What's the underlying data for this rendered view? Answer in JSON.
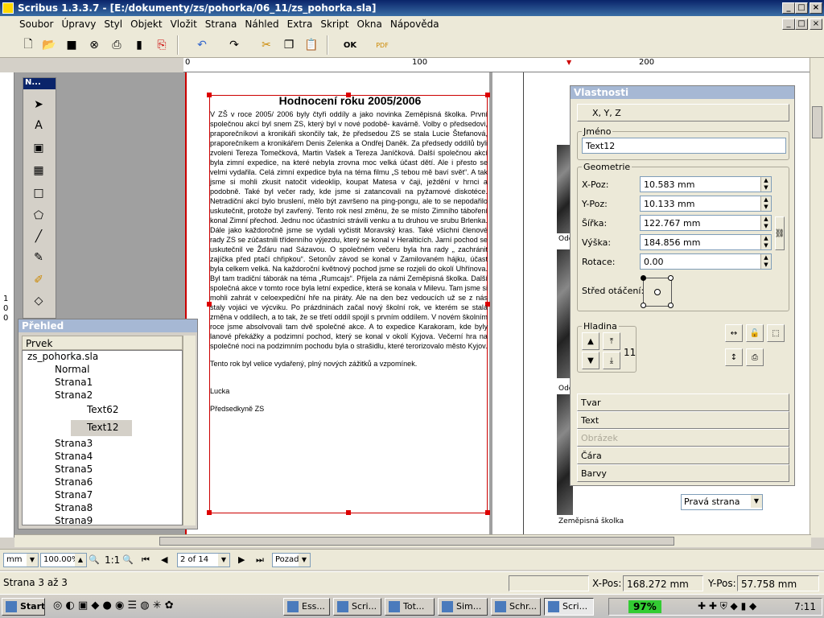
{
  "window": {
    "title": "Scribus 1.3.3.7 - [E:/dokumenty/zs/pohorka/06_11/zs_pohorka.sla]"
  },
  "menu": [
    "Soubor",
    "Úpravy",
    "Styl",
    "Objekt",
    "Vložit",
    "Strana",
    "Náhled",
    "Extra",
    "Skript",
    "Okna",
    "Nápověda"
  ],
  "ruler": {
    "h": [
      "0",
      "100",
      "200"
    ],
    "v": [
      "1",
      "0",
      "0"
    ]
  },
  "document": {
    "title": "Hodnocení roku 2005/2006",
    "paragraphs": [
      "V ZŠ v roce 2005/ 2006 byly čtyři oddíly a jako novinka Zeměpisná školka. První společnou akcí byl snem ZS, který byl v nové podobě- kavárně. Volby o předsedovi, praporečníkovi a kronikáři skončily tak, že předsedou ZS se stala Lucie Štefanová, praporečníkem a kronikářem Denis Zelenka a Ondřej Daněk. Za předsedy oddílů byli zvoleni Tereza Tomečková, Martin Vašek a Tereza Janíčková. Další společnou akcí byla zimní expedice, na které nebyla zrovna moc velká účast dětí. Ale i přesto se velmi vydařila. Celá zimní expedice byla na téma filmu „S tebou mě baví svět“. A tak jsme si mohli zkusit natočit videoklip, koupat Matesa v čaji, ježdění v hrnci a podobně. Také byl večer rady, kde jsme si zatancovali na pyžamové diskotéce. Netradiční akcí bylo bruslení, mělo být završeno na ping-pongu, ale to se nepodařilo uskutečnit, protože byl zavřený. Tento rok nesl změnu, že se místo Zimního táboření konal Zimní přechod. Jednu noc účastníci strávili venku a tu druhou ve srubu Brlenka. Dále jako každoročně jsme se vydali vyčistit Moravský kras. Také všichni členové rady ZS se zúčastnili třídenního výjezdu, který se konal v Heralticích. Jarní pochod se uskutečnil ve Žďáru nad Sázavou. O společném večeru byla hra rady „ zachránit zajíčka před ptačí chřipkou“. Setonův závod se konal v Zamilovaném hájku, účast byla celkem velká. Na každoroční květnový pochod jsme se rozjeli do okolí Uhřínova. Byl tam tradiční táborák na téma „Rumcajs“. Přijela za námi Zeměpisná školka. Další společná akce v tomto roce byla letní expedice, která se konala v Milevu. Tam jsme si mohli zahrát v celoexpediční hře na piráty. Ale na den bez vedoucích už se z nás staly vojáci ve výcviku. Po prázdninách začal nový školní rok, ve kterém se stala změna v oddílech, a to tak, že se třetí oddíl spojil s prvním oddílem. V novém školním roce jsme absolvovali tam dvě společné akce. A to expedice Karakoram, kde byly lanové překážky a podzimní pochod, který se konal v okolí Kyjova. Večerní hra na společné noci na podzimním pochodu byla o strašidlu, které terorizovalo město Kyjov.",
      "Tento rok byl velice vydařený, plný nových zážitků a vzpomínek.",
      "Lucka",
      "Předsedkyně ZS"
    ],
    "right_page_captions": [
      "Ode",
      "Ode",
      "Zeměpisná školka"
    ],
    "page_type": "Pravá strana"
  },
  "tools_palette": {
    "title": "N..."
  },
  "overview": {
    "title": "Přehled",
    "column": "Prvek",
    "tree": [
      "zs_pohorka.sla",
      "Normal",
      "Strana1",
      "Strana2",
      "Text62",
      "Text12",
      "Strana3",
      "Strana4",
      "Strana5",
      "Strana6",
      "Strana7",
      "Strana8",
      "Strana9"
    ]
  },
  "properties": {
    "title": "Vlastnosti",
    "xyz": "X, Y, Z",
    "name_label": "Jméno",
    "name_value": "Text12",
    "geometry_label": "Geometrie",
    "xpos_label": "X-Poz:",
    "xpos": "10.583 mm",
    "ypos_label": "Y-Poz:",
    "ypos": "10.133 mm",
    "width_label": "Šířka:",
    "width": "122.767 mm",
    "height_label": "Výška:",
    "height": "184.856 mm",
    "rotation_label": "Rotace:",
    "rotation": "0.00",
    "pivot_label": "Střed otáčení:",
    "layer_label": "Hladina",
    "layer_value": "11",
    "sections": [
      "Tvar",
      "Text",
      "Obrázek",
      "Čára",
      "Barvy"
    ]
  },
  "bottom_bar": {
    "unit": "mm",
    "zoom": "100.00%",
    "ratio": "1:1",
    "page": "2 of 14",
    "layer": "Pozadí"
  },
  "status": {
    "pages": "Strana 3 až 3",
    "xpos_label": "X-Pos:",
    "xpos": "168.272 mm",
    "ypos_label": "Y-Pos:",
    "ypos": "57.758 mm"
  },
  "taskbar": {
    "start": "Start",
    "tasks": [
      "Ess...",
      "Scri...",
      "Tot...",
      "Sim...",
      "Schr...",
      "Scri..."
    ],
    "battery": "97%",
    "clock": "7:11"
  },
  "colors": {
    "titlebar": "#0a246a",
    "frame": "#cc0000",
    "canvas": "#a0a0a0"
  }
}
